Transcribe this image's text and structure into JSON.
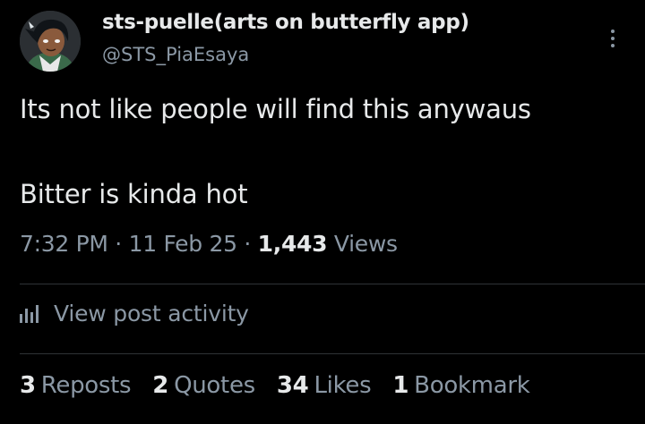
{
  "author": {
    "display_name": "sts-puelle(arts on butterfly app)",
    "handle": "@STS_PiaEsaya"
  },
  "post": {
    "line1": "Its not like people will find this anywaus",
    "line2": "Bitter is kinda hot"
  },
  "meta": {
    "time": "7:32 PM",
    "separator": "·",
    "date": "11 Feb 25",
    "views_count": "1,443",
    "views_label": "Views"
  },
  "activity": {
    "label": "View post activity"
  },
  "stats": [
    {
      "count": "3",
      "label": "Reposts"
    },
    {
      "count": "2",
      "label": "Quotes"
    },
    {
      "count": "34",
      "label": "Likes"
    },
    {
      "count": "1",
      "label": "Bookmark"
    }
  ],
  "colors": {
    "background": "#000000",
    "primary_text": "#e7e9ea",
    "secondary_text": "#8b98a5",
    "divider": "#2f3336"
  },
  "icons": {
    "more": "more-vertical-icon",
    "activity": "bar-chart-icon"
  }
}
